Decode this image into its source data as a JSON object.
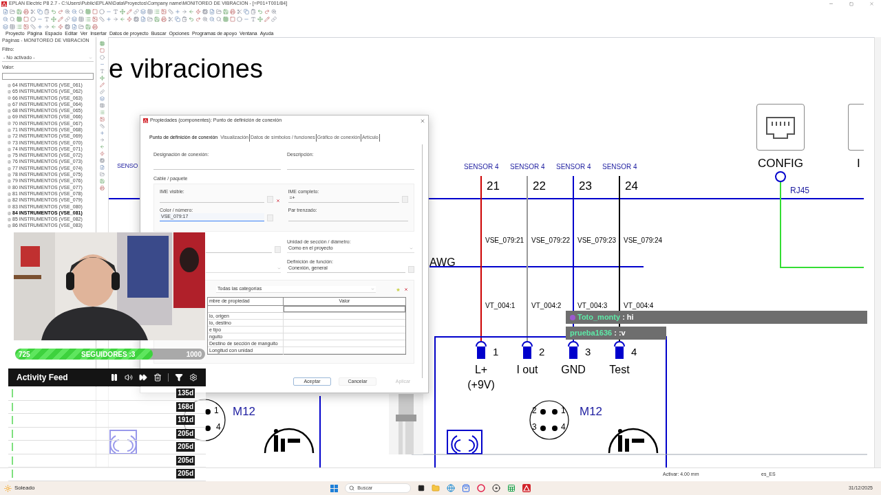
{
  "window": {
    "title": "EPLAN Electric P8 2.7 - C:\\Users\\Public\\EPLAN\\Data\\Proyectos\\Company name\\MONITOREO DE VIBRACION - [=P01+T001/84]"
  },
  "menu": [
    "Proyecto",
    "Página",
    "Espacio",
    "Editar",
    "Ver",
    "Insertar",
    "Datos de proyecto",
    "Buscar",
    "Opciones",
    "Programas de apoyo",
    "Ventana",
    "Ayuda"
  ],
  "pages_panel": {
    "title": "Páginas - MONITOREO DE VIBRACION",
    "filter_label": "Filtro:",
    "filter_value": "- No activado -",
    "value_label": "Valor:",
    "pages": [
      {
        "label": "64 INSTRUMENTOS (VSE_061)",
        "selected": false
      },
      {
        "label": "65 INSTRUMENTOS (VSE_062)",
        "selected": false
      },
      {
        "label": "66 INSTRUMENTOS (VSE_063)",
        "selected": false
      },
      {
        "label": "67 INSTRUMENTOS (VSE_064)",
        "selected": false
      },
      {
        "label": "68 INSTRUMENTOS (VSE_065)",
        "selected": false
      },
      {
        "label": "69 INSTRUMENTOS (VSE_066)",
        "selected": false
      },
      {
        "label": "70 INSTRUMENTOS (VSE_067)",
        "selected": false
      },
      {
        "label": "71 INSTRUMENTOS (VSE_068)",
        "selected": false
      },
      {
        "label": "72 INSTRUMENTOS (VSE_069)",
        "selected": false
      },
      {
        "label": "73 INSTRUMENTOS (VSE_070)",
        "selected": false
      },
      {
        "label": "74 INSTRUMENTOS (VSE_071)",
        "selected": false
      },
      {
        "label": "75 INSTRUMENTOS (VSE_072)",
        "selected": false
      },
      {
        "label": "76 INSTRUMENTOS (VSE_073)",
        "selected": false
      },
      {
        "label": "77 INSTRUMENTOS (VSE_074)",
        "selected": false
      },
      {
        "label": "78 INSTRUMENTOS (VSE_075)",
        "selected": false
      },
      {
        "label": "79 INSTRUMENTOS (VSE_076)",
        "selected": false
      },
      {
        "label": "80 INSTRUMENTOS (VSE_077)",
        "selected": false
      },
      {
        "label": "81 INSTRUMENTOS (VSE_078)",
        "selected": false
      },
      {
        "label": "82 INSTRUMENTOS (VSE_079)",
        "selected": false
      },
      {
        "label": "83 INSTRUMENTOS (VSE_080)",
        "selected": false
      },
      {
        "label": "84 INSTRUMENTOS (VSE_081)",
        "selected": true
      },
      {
        "label": "85 INSTRUMENTOS (VSE_082)",
        "selected": false
      },
      {
        "label": "86 INSTRUMENTOS (VSE_083)",
        "selected": false
      }
    ]
  },
  "canvas": {
    "title": "e vibraciones",
    "left_sensor_label": "SENSO",
    "cable_label": "AWG",
    "terminals": [
      {
        "sensor": "SENSOR 4",
        "number": "21",
        "wire": "VSE_079:21",
        "core": "VT_004:1",
        "color": "#cc0000",
        "pin": "1",
        "function": "L+",
        "note": "(+9V)"
      },
      {
        "sensor": "SENSOR 4",
        "number": "22",
        "wire": "VSE_079:22",
        "core": "VT_004:2",
        "color": "#9a9a9a",
        "pin": "2",
        "function": "I out"
      },
      {
        "sensor": "SENSOR 4",
        "number": "23",
        "wire": "VSE_079:23",
        "core": "VT_004:3",
        "color": "#0000cc",
        "pin": "3",
        "function": "GND"
      },
      {
        "sensor": "SENSOR 4",
        "number": "24",
        "wire": "VSE_079:24",
        "core": "VT_004:4",
        "color": "#000000",
        "pin": "4",
        "function": "Test"
      }
    ],
    "connectors": [
      {
        "label": "M12",
        "pins": [
          "1",
          "4"
        ]
      },
      {
        "label": "M12",
        "pins": [
          "2",
          "1",
          "3",
          "4"
        ]
      }
    ],
    "config": {
      "label": "CONFIG",
      "port": "RJ45"
    },
    "next_label": "I"
  },
  "dialog": {
    "title": "Propiedades (componentes): Punto de definición de conexión",
    "tabs": [
      {
        "label": "Punto de definición de conexión",
        "selected": true
      },
      {
        "label": "Visualización",
        "selected": false
      },
      {
        "label": "Datos de símbolos / funciones",
        "selected": false
      },
      {
        "label": "Gráfico de conexión",
        "selected": false
      },
      {
        "label": "Artículo",
        "selected": false
      }
    ],
    "designation_label": "Designación de conexión:",
    "description_label": "Descripción:",
    "cable_group": "Cable / paquete",
    "ime_visible_label": "IME visible:",
    "ime_full": {
      "label": "IME completo:",
      "value": "=+"
    },
    "color_number": {
      "label": "Color / número:",
      "value": "VSE_079:17"
    },
    "twisted_pair_label": "Par trenzado:",
    "section_unit": {
      "label": "Unidad de sección / diámetro:",
      "value": "Como en el proyecto"
    },
    "function_def": {
      "label": "Definición de función:",
      "value": "Conexión, general"
    },
    "category": "Todas las categorías",
    "table": {
      "columns": [
        "mbre de propiedad",
        "Valor"
      ],
      "rows": [
        "lo, origen",
        "lo, destino",
        "e tipo",
        "nguito",
        "Destino de sección de manguito",
        "Longitud con unidad"
      ]
    },
    "buttons": [
      {
        "label": "Aceptar",
        "disabled": false
      },
      {
        "label": "Cancelar",
        "disabled": false
      },
      {
        "label": "Aplicar",
        "disabled": true
      }
    ]
  },
  "follower_goal": {
    "current": "725",
    "label": "SEGUIDORES :3",
    "target": "1000",
    "level": 0.725
  },
  "activity_feed": {
    "title": "Activity Feed",
    "items": [
      {
        "age": "135d"
      },
      {
        "age": "168d"
      },
      {
        "age": "191d"
      },
      {
        "age": "205d"
      },
      {
        "age": "205d"
      },
      {
        "age": "205d"
      },
      {
        "age": "205d"
      }
    ]
  },
  "chat": [
    {
      "user": "Toto_monty",
      "message": " : hi"
    },
    {
      "user": "prueba1636",
      "message": " : :v"
    }
  ],
  "status_bar": {
    "snap": "Activar: 4.00 mm",
    "locale": "es_ES"
  },
  "taskbar": {
    "weather": "Soleado",
    "search_placeholder": "Buscar",
    "date": "31/12/2025"
  }
}
